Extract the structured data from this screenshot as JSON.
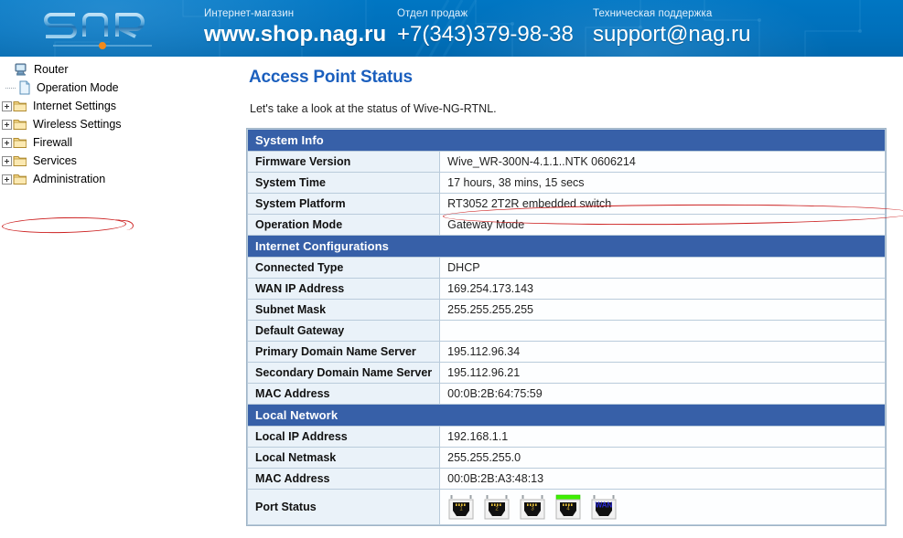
{
  "banner": {
    "logo_text": "SNR",
    "contacts": [
      {
        "id": "shop",
        "caption": "Интернет-магазин",
        "value": "www.shop.nag.ru",
        "bold": true
      },
      {
        "id": "sales",
        "caption": "Отдел продаж",
        "value": "+7(343)379-98-38",
        "bold": false
      },
      {
        "id": "support",
        "caption": "Техническая поддержка",
        "value": "support@nag.ru",
        "bold": false
      }
    ]
  },
  "sidebar": {
    "items": [
      {
        "label": "Router",
        "icon": "router-icon",
        "type": "root",
        "expander": false
      },
      {
        "label": "Operation Mode",
        "icon": "page-icon",
        "type": "leaf",
        "expander": false
      },
      {
        "label": "Internet Settings",
        "icon": "folder-icon",
        "type": "folder",
        "expander": true
      },
      {
        "label": "Wireless Settings",
        "icon": "folder-icon",
        "type": "folder",
        "expander": true
      },
      {
        "label": "Firewall",
        "icon": "folder-icon",
        "type": "folder",
        "expander": true
      },
      {
        "label": "Services",
        "icon": "folder-icon",
        "type": "folder",
        "expander": true
      },
      {
        "label": "Administration",
        "icon": "folder-icon",
        "type": "folder",
        "expander": true
      }
    ]
  },
  "main": {
    "title": "Access Point Status",
    "intro": "Let's take a look at the status of Wive-NG-RTNL.",
    "sections": [
      {
        "heading": "System Info",
        "rows": [
          {
            "label": "Firmware Version",
            "value": "Wive_WR-300N-4.1.1..NTK 0606214"
          },
          {
            "label": "System Time",
            "value": "17 hours, 38 mins, 15 secs"
          },
          {
            "label": "System Platform",
            "value": "RT3052 2T2R embedded switch"
          },
          {
            "label": "Operation Mode",
            "value": "Gateway Mode"
          }
        ]
      },
      {
        "heading": "Internet Configurations",
        "rows": [
          {
            "label": "Connected Type",
            "value": "DHCP"
          },
          {
            "label": "WAN IP Address",
            "value": "169.254.173.143"
          },
          {
            "label": "Subnet Mask",
            "value": "255.255.255.255"
          },
          {
            "label": "Default Gateway",
            "value": ""
          },
          {
            "label": "Primary Domain Name Server",
            "value": "195.112.96.34"
          },
          {
            "label": "Secondary Domain Name Server",
            "value": "195.112.96.21"
          },
          {
            "label": "MAC Address",
            "value": "00:0B:2B:64:75:59"
          }
        ]
      },
      {
        "heading": "Local Network",
        "rows": [
          {
            "label": "Local IP Address",
            "value": "192.168.1.1"
          },
          {
            "label": "Local Netmask",
            "value": "255.255.255.0"
          },
          {
            "label": "MAC Address",
            "value": "00:0B:2B:A3:48:13"
          }
        ],
        "port_status": {
          "label": "Port Status",
          "ports": [
            {
              "name": "1",
              "link": false
            },
            {
              "name": "2",
              "link": false
            },
            {
              "name": "3",
              "link": false
            },
            {
              "name": "4",
              "link": true
            },
            {
              "name": "WAN",
              "link": false
            }
          ]
        }
      }
    ]
  },
  "annotations": [
    {
      "name": "ellipse-administration",
      "target": "Administration"
    },
    {
      "name": "ellipse-firmware-version",
      "target": "Firmware Version"
    }
  ],
  "colors": {
    "banner_blue": "#0070bb",
    "section_header_blue": "#3760a8",
    "title_blue": "#1b5fbe",
    "label_cell": "#eaf2f9",
    "annotation_red": "#cc1f1f",
    "port_link_green": "#3ef000"
  }
}
